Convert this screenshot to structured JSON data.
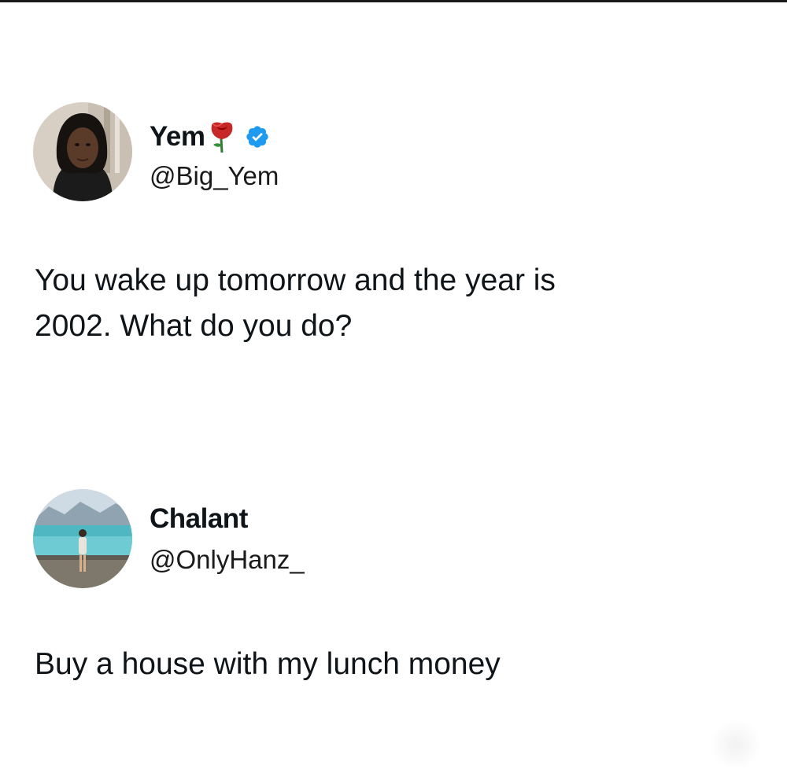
{
  "post": {
    "author": {
      "display_name": "Yem",
      "handle": "@Big_Yem",
      "emoji_icon": "rose-icon",
      "verified": true,
      "verified_color": "#1d9bf0"
    },
    "text_lines": [
      "You wake up tomorrow and the year is",
      "2002. What do you do?"
    ]
  },
  "reply": {
    "author": {
      "display_name": "Chalant",
      "handle": "@OnlyHanz_"
    },
    "text": "Buy a house with my lunch money"
  }
}
